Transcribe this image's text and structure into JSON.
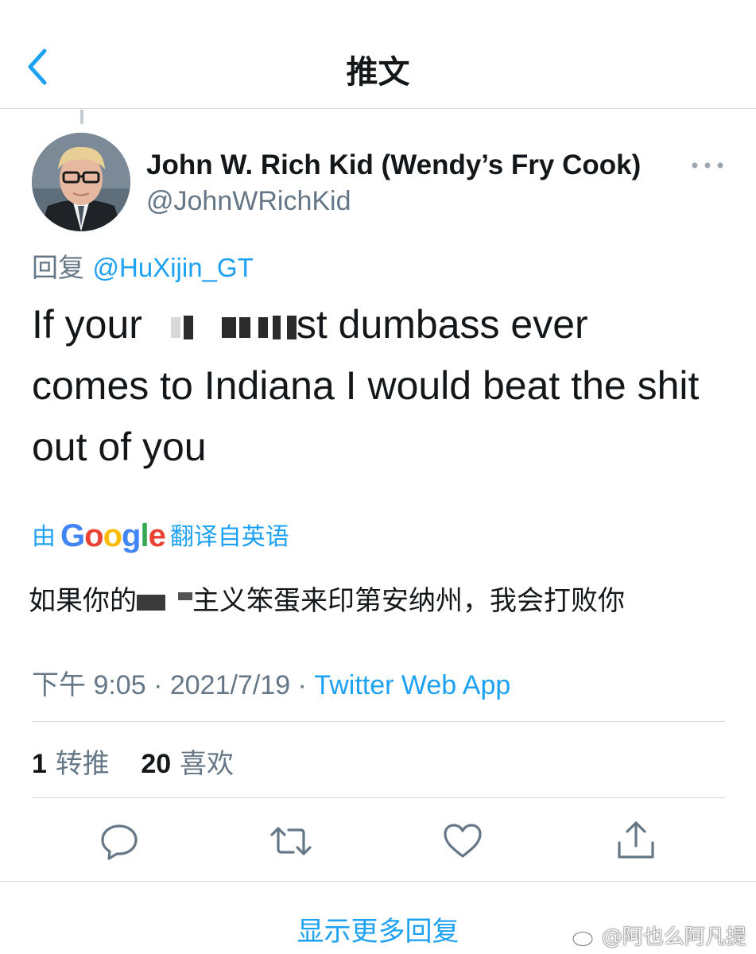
{
  "header": {
    "title": "推文",
    "back_icon": "chevron-left-icon"
  },
  "tweet": {
    "display_name": "John W. Rich Kid (Wendy’s Fry Cook)",
    "handle": "@JohnWRichKid",
    "more_icon": "more-horizontal-icon",
    "reply_prefix": "回复",
    "reply_to": "@HuXijin_GT",
    "text": {
      "line1_start": "If your",
      "line1_end": "st dumbass ever",
      "line2": "comes to Indiana I would beat the shit",
      "line3": "out of you"
    },
    "translate": {
      "prefix": "由",
      "provider": "Google",
      "suffix": "翻译自英语"
    },
    "translation": {
      "start": "如果你的",
      "end": "主义笨蛋来印第安纳州，我会打败你"
    },
    "time": "下午 9:05",
    "sep1": " · ",
    "date": "2021/7/19",
    "sep2": " · ",
    "source": "Twitter Web App"
  },
  "stats": {
    "retweets_count": "1",
    "retweets_label": "转推",
    "likes_count": "20",
    "likes_label": "喜欢"
  },
  "actions": {
    "reply_icon": "reply-icon",
    "retweet_icon": "retweet-icon",
    "like_icon": "heart-icon",
    "share_icon": "share-icon"
  },
  "footer": {
    "show_more": "显示更多回复"
  },
  "watermark": "@阿也么阿凡提",
  "colors": {
    "accent": "#1da1f2",
    "secondary_text": "#657786",
    "primary_text": "#14171a",
    "divider": "#d6dbe0"
  }
}
